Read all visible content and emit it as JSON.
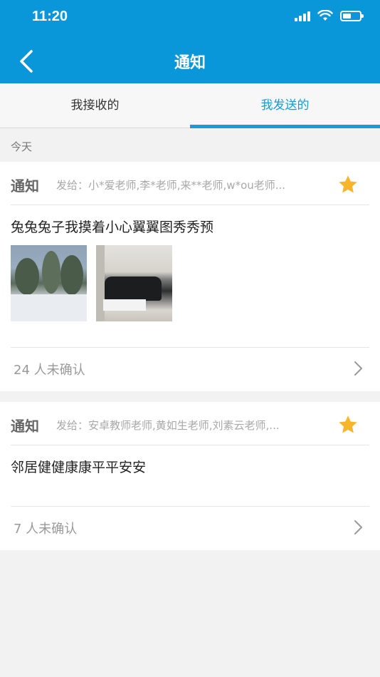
{
  "status_bar": {
    "time": "11:20"
  },
  "nav": {
    "title": "通知",
    "back_icon": "chevron-left-icon"
  },
  "tabs": [
    {
      "label": "我接收的",
      "active": false
    },
    {
      "label": "我发送的",
      "active": true
    }
  ],
  "section": {
    "date_label": "今天"
  },
  "notices": [
    {
      "type": "通知",
      "recipients": "发给：小*爱老师,李*老师,来**老师,w*ou老师...",
      "starred": true,
      "content": "兔兔兔子我摸着小心翼翼图秀秀预",
      "images": [
        "snow-landscape-photo",
        "car-showroom-photo"
      ],
      "unconfirmed": "24 人未确认"
    },
    {
      "type": "通知",
      "recipients": "发给：安卓教师老师,黄如生老师,刘素云老师,...",
      "starred": true,
      "content": "邻居健健康康平平安安",
      "images": [],
      "unconfirmed": "7 人未确认"
    }
  ],
  "colors": {
    "primary": "#0a97d9",
    "tab_active": "#1a9ad6",
    "star": "#f7b52c"
  }
}
